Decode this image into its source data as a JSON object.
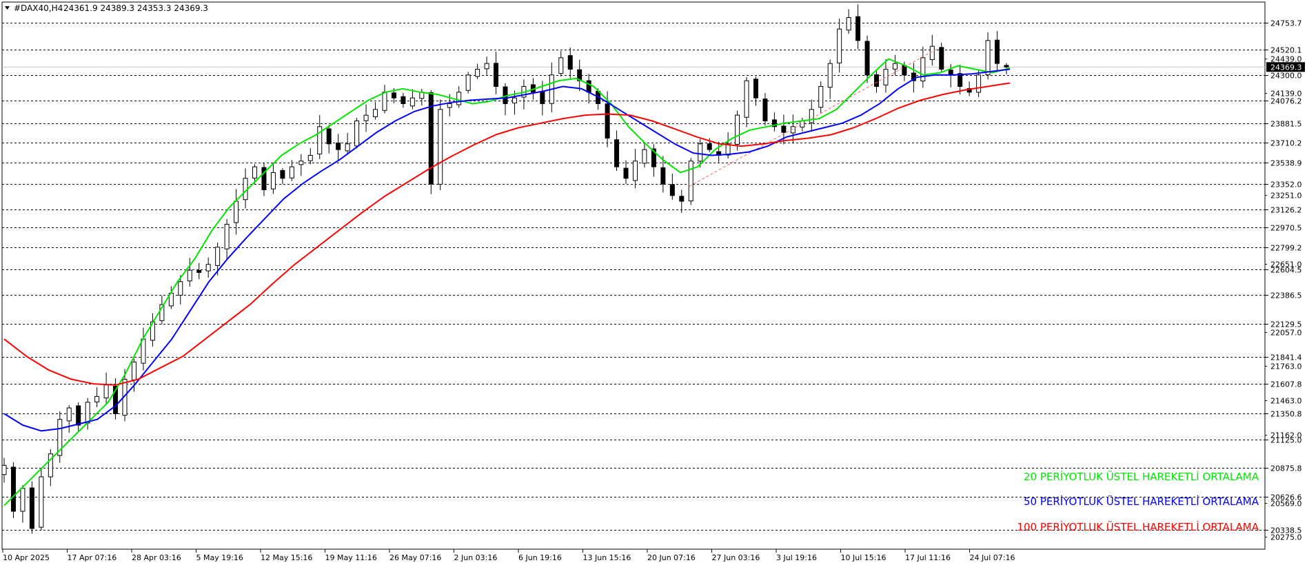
{
  "header": {
    "symbol": "#DAX40,H4",
    "ohlc": "24361.9 24389.3 24353.3 24369.3"
  },
  "colors": {
    "ema20": "#00e600",
    "ema50": "#0000ff",
    "ema100": "#ff0000",
    "bull": "#000000",
    "bear": "#000000",
    "current_price_tag": "#000000",
    "channel": "#ff6060"
  },
  "chart_data": {
    "type": "line",
    "instrument": "#DAX40",
    "timeframe": "H4",
    "ylim": [
      20170,
      24935
    ],
    "x_ticks": [
      "10 Apr 2025",
      "17 Apr 07:16",
      "28 Apr 03:16",
      "5 May 19:16",
      "12 May 15:16",
      "19 May 11:16",
      "26 May 07:16",
      "2 Jun 03:16",
      "6 Jun 19:16",
      "13 Jun 15:16",
      "20 Jun 07:16",
      "27 Jun 03:16",
      "3 Jul 19:16",
      "10 Jul 15:16",
      "17 Jul 11:16",
      "24 Jul 07:16"
    ],
    "horizontal_levels": [
      24753.7,
      24520.1,
      24300.0,
      24076.2,
      23881.5,
      23710.2,
      23538.9,
      23352.0,
      23126.2,
      22970.5,
      22799.2,
      22604.5,
      22386.5,
      22129.5,
      21841.4,
      21607.8,
      21350.8,
      21125.0,
      20875.8,
      20626.6,
      20338.5
    ],
    "price_scale_labels": [
      24439.0,
      24139.0,
      23251.0,
      22651.0,
      22057.0,
      21763.0,
      21463.0,
      21162.0,
      20569.0,
      20275.0
    ],
    "current_price": 24369.3,
    "legend": [
      {
        "label": "20 PERİYOTLUK ÜSTEL HAREKETLİ ORTALAMA",
        "color": "#00e600"
      },
      {
        "label": "50 PERİYOTLUK ÜSTEL HAREKETLİ ORTALAMA",
        "color": "#0000ff"
      },
      {
        "label": "100 PERİYOTLUK ÜSTEL HAREKETLİ ORTALAMA",
        "color": "#ff0000"
      }
    ],
    "price_series": [
      20900,
      20500,
      20700,
      20350,
      20800,
      21000,
      21300,
      21400,
      21250,
      21450,
      21500,
      21600,
      21350,
      21650,
      21800,
      22000,
      22150,
      22300,
      22400,
      22500,
      22600,
      22580,
      22650,
      22800,
      23000,
      23200,
      23400,
      23500,
      23300,
      23450,
      23400,
      23500,
      23550,
      23600,
      23850,
      23700,
      23650,
      23700,
      23900,
      23950,
      24000,
      24150,
      24100,
      24050,
      24100,
      24150,
      23350,
      24000,
      24050,
      24150,
      24300,
      24350,
      24400,
      24200,
      24050,
      24100,
      24200,
      24150,
      24050,
      24300,
      24450,
      24350,
      24250,
      24150,
      24050,
      23750,
      23500,
      23400,
      23550,
      23650,
      23500,
      23350,
      23250,
      23200,
      23550,
      23700,
      23650,
      23600,
      23700,
      23950,
      24250,
      24100,
      23900,
      23850,
      23800,
      23850,
      23900,
      24000,
      24200,
      24400,
      24700,
      24800,
      24600,
      24300,
      24200,
      24350,
      24400,
      24300,
      24250,
      24450,
      24550,
      24350,
      24300,
      24200,
      24150,
      24300,
      24600,
      24400,
      24370
    ],
    "series": [
      {
        "period": 20,
        "values": [
          20550,
          20700,
          20850,
          21000,
          21150,
          21300,
          21450,
          21700,
          22000,
          22250,
          22500,
          22700,
          22950,
          23150,
          23300,
          23450,
          23600,
          23700,
          23780,
          23880,
          23980,
          24080,
          24150,
          24180,
          24150,
          24130,
          24090,
          24050,
          24070,
          24120,
          24150,
          24200,
          24250,
          24270,
          24200,
          24050,
          23850,
          23700,
          23560,
          23450,
          23500,
          23650,
          23750,
          23820,
          23850,
          23880,
          23900,
          23920,
          24000,
          24150,
          24300,
          24440,
          24380,
          24300,
          24320,
          24380,
          24350,
          24320,
          24360
        ]
      },
      {
        "period": 50,
        "values": [
          21350,
          21250,
          21200,
          21220,
          21260,
          21300,
          21420,
          21600,
          21800,
          22000,
          22250,
          22500,
          22700,
          22880,
          23050,
          23220,
          23350,
          23460,
          23560,
          23680,
          23800,
          23900,
          23980,
          24030,
          24060,
          24080,
          24090,
          24100,
          24130,
          24160,
          24200,
          24180,
          24100,
          24000,
          23900,
          23800,
          23700,
          23620,
          23600,
          23610,
          23630,
          23680,
          23760,
          23800,
          23840,
          23880,
          23950,
          24050,
          24180,
          24280,
          24300,
          24300,
          24310,
          24330,
          24350
        ]
      },
      {
        "period": 100,
        "values": [
          22000,
          21850,
          21730,
          21650,
          21610,
          21600,
          21650,
          21750,
          21850,
          22000,
          22150,
          22300,
          22480,
          22650,
          22800,
          22950,
          23100,
          23240,
          23360,
          23480,
          23590,
          23690,
          23780,
          23840,
          23880,
          23920,
          23950,
          23960,
          23950,
          23900,
          23830,
          23760,
          23700,
          23680,
          23700,
          23730,
          23750,
          23780,
          23840,
          23920,
          24010,
          24080,
          24130,
          24170,
          24200,
          24230
        ]
      }
    ]
  }
}
